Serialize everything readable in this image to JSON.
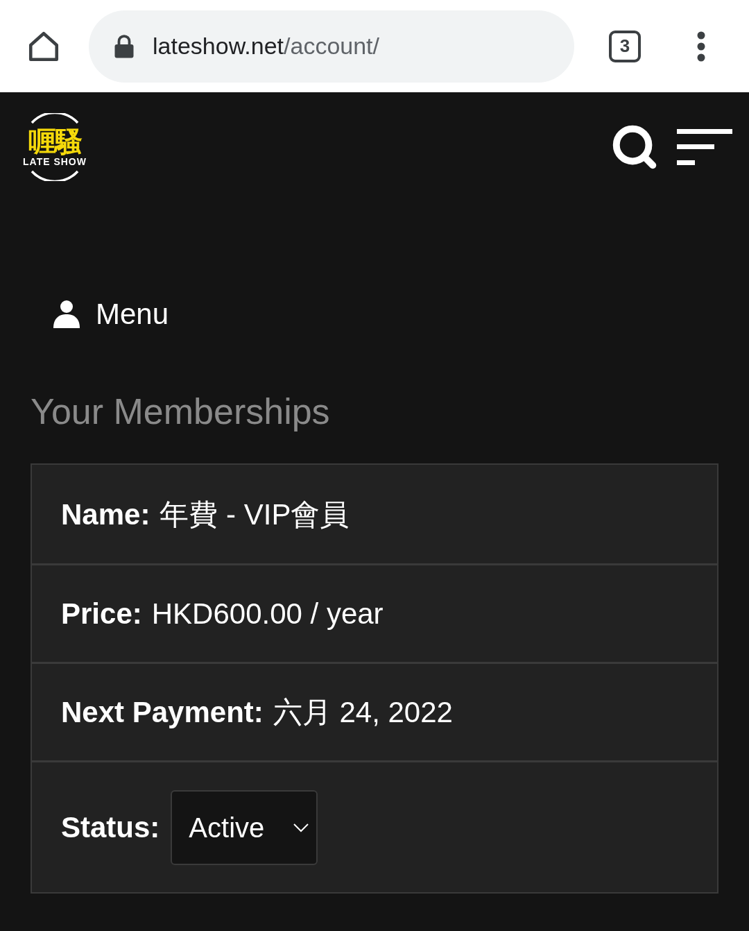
{
  "browser": {
    "url_host": "lateshow.net",
    "url_path": "/account/",
    "tab_count": "3"
  },
  "header": {
    "logo_chinese": "喱騷",
    "logo_english": "LATE SHOW"
  },
  "account_menu": {
    "label": "Menu"
  },
  "memberships": {
    "title": "Your Memberships",
    "rows": [
      {
        "kind": "text",
        "label": "Name:",
        "value": "年費 - VIP會員"
      },
      {
        "kind": "text",
        "label": "Price:",
        "value": "HKD600.00 / year"
      },
      {
        "kind": "text",
        "label": "Next Payment:",
        "value": "六月 24, 2022"
      },
      {
        "kind": "select",
        "label": "Status:",
        "value": "Active"
      }
    ]
  }
}
